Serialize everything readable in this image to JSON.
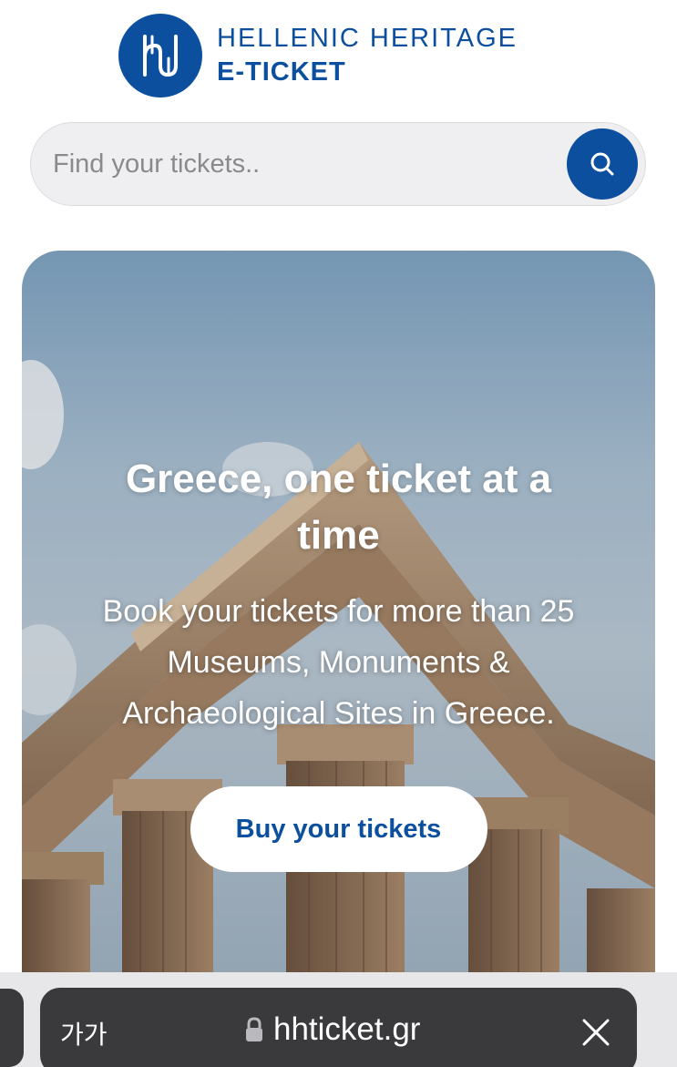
{
  "brand": {
    "line1": "HELLENIC HERITAGE",
    "line2": "E-TICKET",
    "logo_icon": "hh-monogram-icon",
    "color": "#0b4f9e"
  },
  "search": {
    "placeholder": "Find your tickets..",
    "button_icon": "search-icon"
  },
  "hero": {
    "title": "Greece, one ticket at a time",
    "subtitle": "Book your tickets for more than 25 Museums, Monuments & Archaeological Sites in Greece.",
    "cta_label": "Buy your tickets"
  },
  "browser": {
    "text_size_label": "가가",
    "url": "hhticket.gr",
    "lock_icon": "lock-icon",
    "close_icon": "close-icon"
  }
}
